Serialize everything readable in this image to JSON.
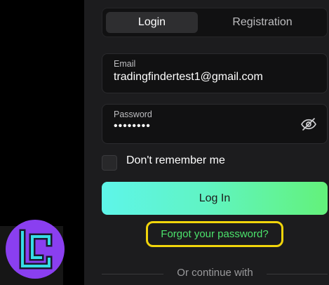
{
  "tabs": {
    "login": "Login",
    "registration": "Registration"
  },
  "email": {
    "label": "Email",
    "value": "tradingfindertest1@gmail.com"
  },
  "password": {
    "label": "Password",
    "value": "••••••••"
  },
  "icons": {
    "password_toggle": "eye-slash-icon",
    "logo": "tradingfinder-logo-icon"
  },
  "remember": {
    "label": "Don't remember me",
    "checked": false
  },
  "login_button": "Log In",
  "forgot_password": "Forgot your password?",
  "continue_with": "Or continue with",
  "colors": {
    "background": "#000000",
    "panel": "#1c1c1e",
    "accent_start": "#5ef5e9",
    "accent_end": "#63f27a",
    "link": "#4be36c",
    "highlight": "#f1d50b",
    "logo": "#8a3ff0"
  }
}
